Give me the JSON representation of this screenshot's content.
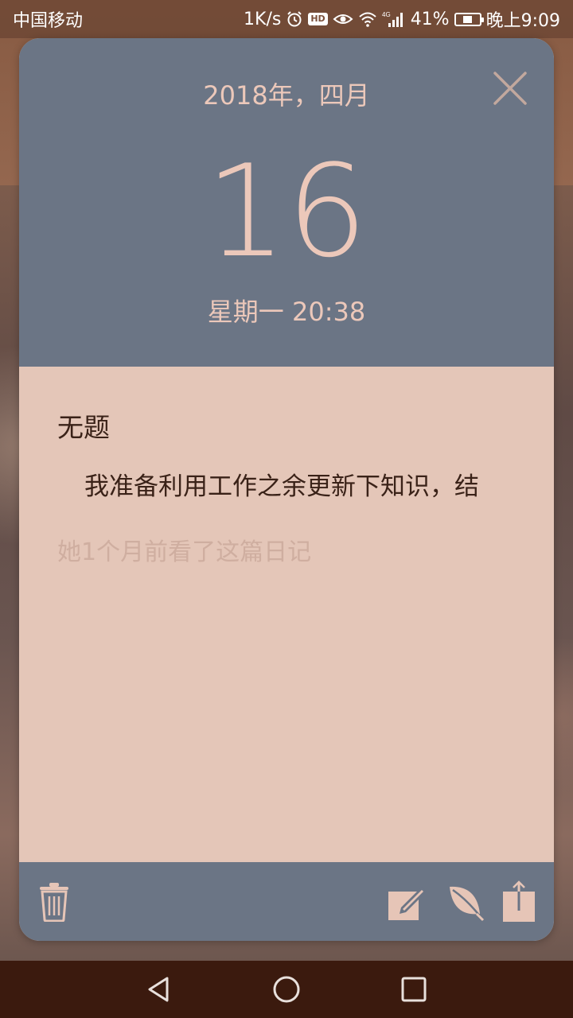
{
  "status_bar": {
    "carrier": "中国移动",
    "speed": "1K/s",
    "hd_label": "HD",
    "network_label": "4G",
    "battery": "41%",
    "battery_level": 0.41,
    "time": "晚上9:09",
    "icons": [
      "alarm-icon",
      "hd-icon",
      "eye-icon",
      "wifi-icon",
      "signal-icon",
      "battery-icon"
    ]
  },
  "diary": {
    "month_year": "2018年，四月",
    "day": "16",
    "weekday_time": "星期一 20:38",
    "title": "无题",
    "content": "我准备利用工作之余更新下知识，结",
    "read_info": "她1个月前看了这篇日记"
  },
  "toolbar": {
    "icons": [
      "trash-icon",
      "edit-icon",
      "leaf-icon",
      "share-icon"
    ]
  },
  "nav": {
    "icons": [
      "back-icon",
      "home-icon",
      "recent-apps-icon"
    ]
  },
  "colors": {
    "header_bg": "#6b7585",
    "body_bg": "#e4c6b8",
    "accent_text": "#ecc8ba",
    "nav_bg": "#3b1a0e"
  }
}
